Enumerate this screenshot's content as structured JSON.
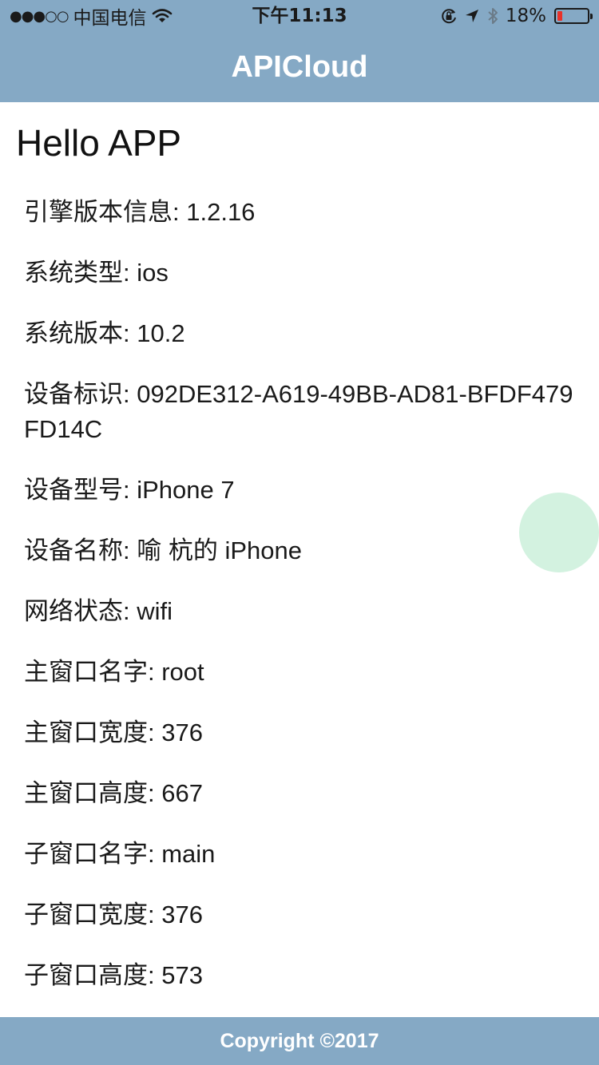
{
  "status_bar": {
    "signal": "●●●○○",
    "carrier": "中国电信",
    "time": "下午11:13",
    "battery_percent": "18%",
    "battery_level": 0.18,
    "icons": [
      "wifi-icon",
      "rotation-lock-icon",
      "location-arrow-icon",
      "bluetooth-icon",
      "battery-icon"
    ]
  },
  "header": {
    "title": "APICloud"
  },
  "main": {
    "heading": "Hello APP",
    "info": [
      {
        "label": "引擎版本信息",
        "value": "1.2.16"
      },
      {
        "label": "系统类型",
        "value": "ios"
      },
      {
        "label": "系统版本",
        "value": "10.2"
      },
      {
        "label": "设备标识",
        "value": "092DE312-A619-49BB-AD81-BFDF479FD14C"
      },
      {
        "label": "设备型号",
        "value": "iPhone 7"
      },
      {
        "label": "设备名称",
        "value": "喻 杭的 iPhone"
      },
      {
        "label": "网络状态",
        "value": "wifi"
      },
      {
        "label": "主窗口名字",
        "value": "root"
      },
      {
        "label": "主窗口宽度",
        "value": "376"
      },
      {
        "label": "主窗口高度",
        "value": "667"
      },
      {
        "label": "子窗口名字",
        "value": "main"
      },
      {
        "label": "子窗口宽度",
        "value": "376"
      },
      {
        "label": "子窗口高度",
        "value": "573"
      }
    ]
  },
  "footer": {
    "text": "Copyright ©2017"
  },
  "colors": {
    "bar": "#85a9c5",
    "float_ball": "#d3f2e0",
    "battery_low": "#e8322a"
  }
}
